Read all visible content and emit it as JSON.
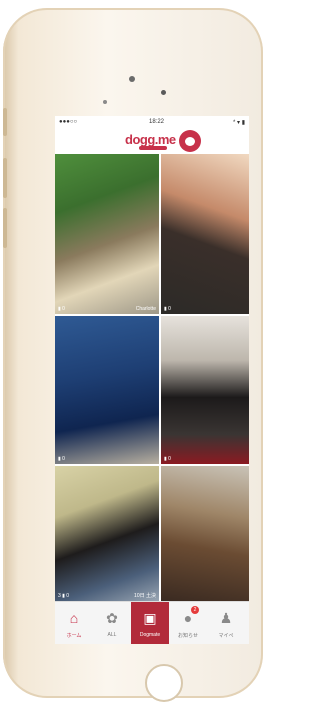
{
  "status_bar": {
    "carrier": "●●●○○",
    "time": "18:22",
    "right": "* ▾ ▮"
  },
  "app": {
    "logo": "dogg.me"
  },
  "tiles": [
    {
      "meta": "▮ 0",
      "user": "Charlotte"
    },
    {
      "meta": "▮ 0",
      "user": ""
    },
    {
      "meta": "▮ 0",
      "user": ""
    },
    {
      "meta": "▮ 0",
      "user": ""
    },
    {
      "meta": "3 ▮ 0",
      "user": "10日 土決"
    },
    {
      "meta": "",
      "user": ""
    },
    {
      "meta": "",
      "user": ""
    },
    {
      "meta": "",
      "user": ""
    }
  ],
  "tabs": [
    {
      "label": "ホーム",
      "icon": "home-icon",
      "glyph": "⌂"
    },
    {
      "label": "ALL",
      "icon": "paw-icon",
      "glyph": "✿"
    },
    {
      "label": "Dogmate",
      "icon": "camera-icon",
      "glyph": "▣"
    },
    {
      "label": "お知らせ",
      "icon": "chat-icon",
      "glyph": "●",
      "badge": "2"
    },
    {
      "label": "マイペ",
      "icon": "person-icon",
      "glyph": "♟"
    }
  ],
  "colors": {
    "brand": "#c7314a",
    "tab_active": "#b22a3a"
  }
}
